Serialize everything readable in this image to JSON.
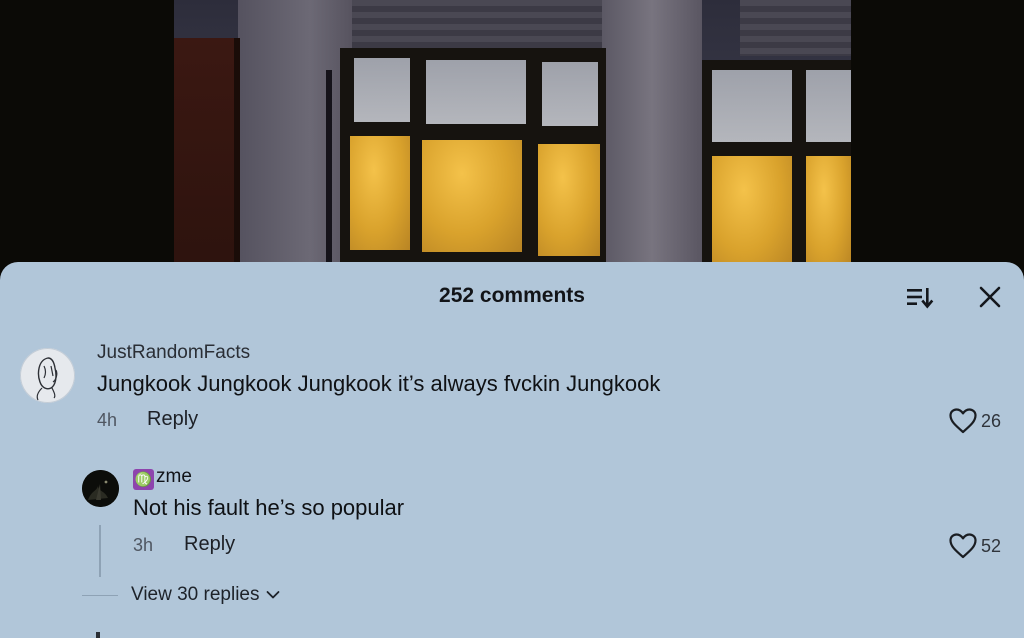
{
  "sheet": {
    "title": "252 comments"
  },
  "header": {
    "sort_icon": "sort-icon",
    "close_icon": "close-icon"
  },
  "comments": [
    {
      "username": "JustRandomFacts",
      "text": "Jungkook Jungkook Jungkook it’s always fvckin Jungkook",
      "time": "4h",
      "reply_label": "Reply",
      "likes": "26"
    }
  ],
  "replies": [
    {
      "zodiac": "♍",
      "username": "zme",
      "text": "Not his fault he’s so popular",
      "time": "3h",
      "reply_label": "Reply",
      "likes": "52"
    }
  ],
  "view_replies": {
    "label": "View 30 replies"
  },
  "colors": {
    "sheet_bg": "#b1c6d9",
    "text": "#121418",
    "muted": "#4f5661",
    "zodiac_badge": "#8e44ad"
  }
}
